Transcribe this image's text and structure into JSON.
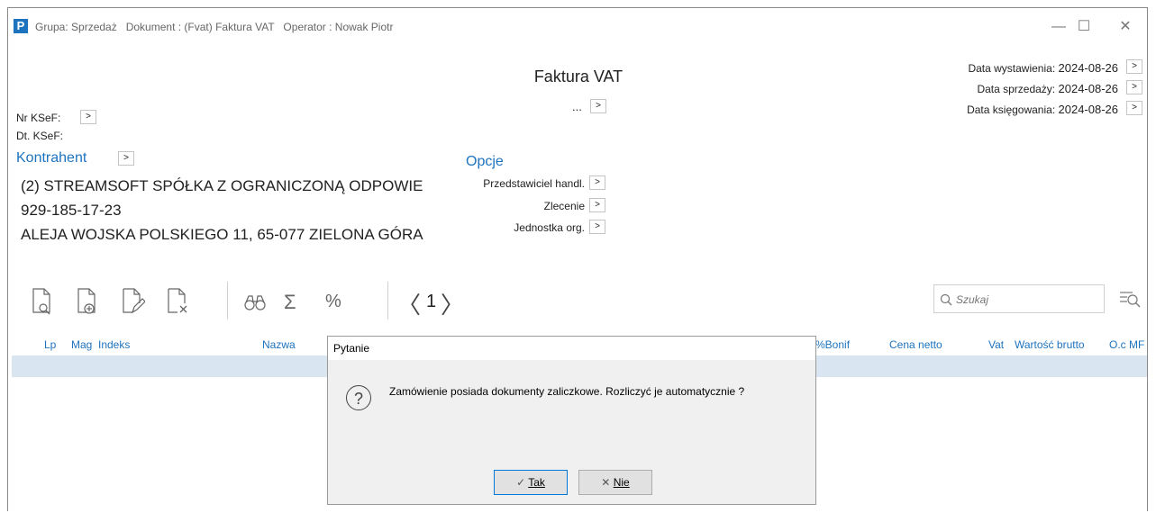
{
  "window": {
    "logo": "P",
    "title": "Grupa: Sprzedaż   Dokument : (Fvat) Faktura VAT   Operator : Nowak Piotr",
    "minimize": "—",
    "maximize": "☐",
    "close": "✕"
  },
  "doc": {
    "title": "Faktura VAT",
    "number": "..."
  },
  "arrow": ">",
  "ksef": {
    "nr_label": "Nr KSeF:",
    "dt_label": "Dt. KSeF:"
  },
  "dates": [
    {
      "label": "Data wystawienia:",
      "value": "2024-08-26"
    },
    {
      "label": "Data sprzedaży:",
      "value": "2024-08-26"
    },
    {
      "label": "Data księgowania:",
      "value": "2024-08-26"
    }
  ],
  "kontrahent": {
    "heading": "Kontrahent",
    "name": "(2) STREAMSOFT SPÓŁKA Z OGRANICZONĄ ODPOWIE",
    "nip": "929-185-17-23",
    "address": "ALEJA WOJSKA POLSKIEGO 11, 65-077 ZIELONA GÓRA"
  },
  "opcje": {
    "heading": "Opcje",
    "items": [
      "Przedstawiciel handl.",
      "Zlecenie",
      "Jednostka org."
    ]
  },
  "toolbar": {
    "sigma": "Σ",
    "percent": "%",
    "prev": "〈",
    "page": "1",
    "next": "〉"
  },
  "search": {
    "placeholder": "Szukaj"
  },
  "table": {
    "headers": [
      "Lp",
      "Mag",
      "Indeks",
      "Nazwa",
      "%Bonif",
      "Cena netto",
      "Vat",
      "Wartość brutto",
      "O.c MF"
    ]
  },
  "dialog": {
    "title": "Pytanie",
    "icon": "?",
    "message": "Zamówienie posiada dokumenty zaliczkowe. Rozliczyć je automatycznie ?",
    "yes_icon": "✓",
    "yes_label": "Tak",
    "no_icon": "✕",
    "no_label": "Nie"
  },
  "colors": {
    "accent": "#1e73be",
    "selected_row": "#d9e6f2",
    "dialog_bg": "#f0f0f0"
  }
}
